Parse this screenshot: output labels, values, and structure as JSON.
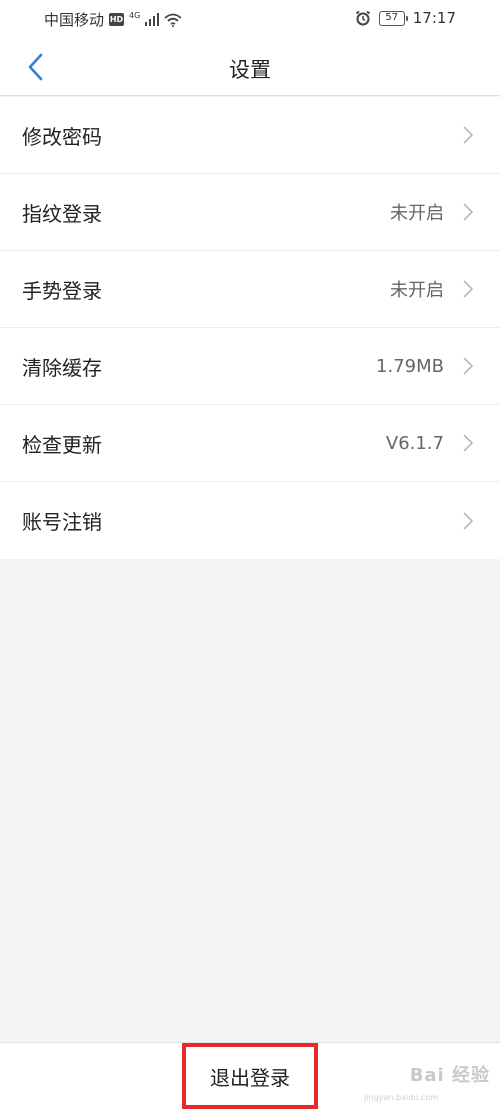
{
  "status_bar": {
    "carrier": "中国移动",
    "hd_badge": "HD",
    "network_type": "4G",
    "battery_level": "57",
    "time": "17:17"
  },
  "header": {
    "title": "设置"
  },
  "settings": {
    "items": [
      {
        "label": "修改密码",
        "value": ""
      },
      {
        "label": "指纹登录",
        "value": "未开启"
      },
      {
        "label": "手势登录",
        "value": "未开启"
      },
      {
        "label": "清除缓存",
        "value": "1.79MB"
      },
      {
        "label": "检查更新",
        "value": "V6.1.7"
      },
      {
        "label": "账号注销",
        "value": ""
      }
    ]
  },
  "footer": {
    "logout_label": "退出登录",
    "watermark": "Bai 经验",
    "watermark_sub": "jingyan.baidu.com"
  },
  "colors": {
    "accent_blue": "#3a7bd5",
    "highlight_red": "#e42a2a",
    "background": "#f4f4f4"
  }
}
